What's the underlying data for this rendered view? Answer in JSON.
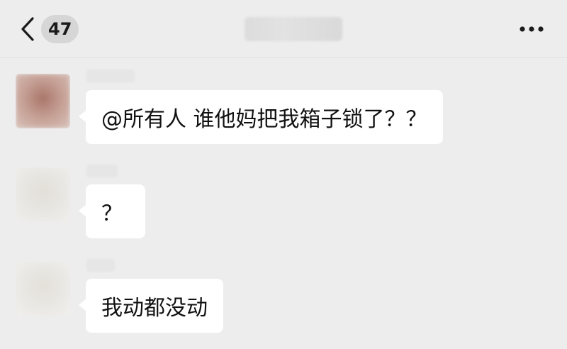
{
  "header": {
    "back_label": "back",
    "unread_count": "47",
    "title_redacted": ""
  },
  "messages": [
    {
      "sender_redacted": "",
      "text": "@所有人 谁他妈把我箱子锁了？？",
      "avatar_color": "#b89287"
    },
    {
      "sender_redacted": "",
      "text": "？",
      "avatar_color": "#e8e6e1"
    },
    {
      "sender_redacted": "",
      "text": "我动都没动",
      "avatar_color": "#e9e7e2"
    }
  ],
  "colors": {
    "background": "#ededed",
    "bubble": "#ffffff",
    "badge": "#d6d6d6"
  },
  "icons": {
    "back": "chevron-left-icon",
    "more": "more-dots-icon"
  }
}
